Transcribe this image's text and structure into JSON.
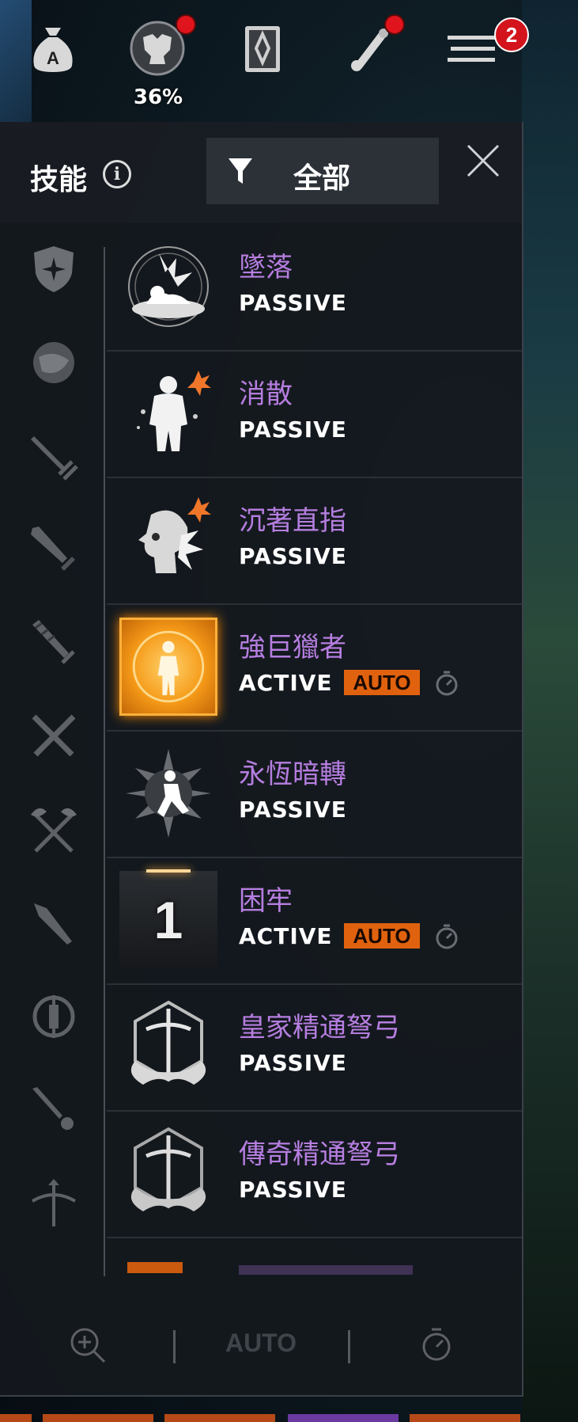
{
  "hud": {
    "buttons": [
      {
        "name": "bag-icon",
        "has_dot": false
      },
      {
        "name": "armor-icon",
        "has_dot": true,
        "percent": "36%"
      },
      {
        "name": "codex-icon",
        "has_dot": false
      },
      {
        "name": "scroll-icon",
        "has_dot": true
      },
      {
        "name": "menu-icon",
        "badge": "2"
      }
    ]
  },
  "panel": {
    "title": "技能",
    "filter_label": "全部"
  },
  "sidebar": {
    "categories": [
      "shield-star-icon",
      "orb-icon",
      "sword-shield-icon",
      "sword-icon",
      "greatsword-icon",
      "crossed-swords-icon",
      "crossed-axes-icon",
      "spear-icon",
      "mace-icon",
      "dagger-icon",
      "crossbow-icon"
    ]
  },
  "skills": [
    {
      "name": "墜落",
      "type": "PASSIVE",
      "auto": "",
      "icon": "fall-icon"
    },
    {
      "name": "消散",
      "type": "PASSIVE",
      "auto": "",
      "icon": "dissipate-icon"
    },
    {
      "name": "沉著直指",
      "type": "PASSIVE",
      "auto": "",
      "icon": "calm-point-icon"
    },
    {
      "name": "強巨獵者",
      "type": "ACTIVE",
      "auto": "AUTO",
      "icon": "giant-hunter-icon"
    },
    {
      "name": "永恆暗轉",
      "type": "PASSIVE",
      "auto": "",
      "icon": "eternal-dark-icon"
    },
    {
      "name": "困牢",
      "type": "ACTIVE",
      "auto": "AUTO",
      "icon": "prison-icon",
      "count": "1"
    },
    {
      "name": "皇家精通弩弓",
      "type": "PASSIVE",
      "auto": "",
      "icon": "royal-crossbow-icon"
    },
    {
      "name": "傳奇精通弩弓",
      "type": "PASSIVE",
      "auto": "",
      "icon": "legendary-crossbow-icon"
    }
  ],
  "footer": {
    "auto_label": "AUTO"
  },
  "colors": {
    "skill_name": "#b67ee0",
    "auto_tag": "#e0620e",
    "panel_bg": "#14181e"
  }
}
